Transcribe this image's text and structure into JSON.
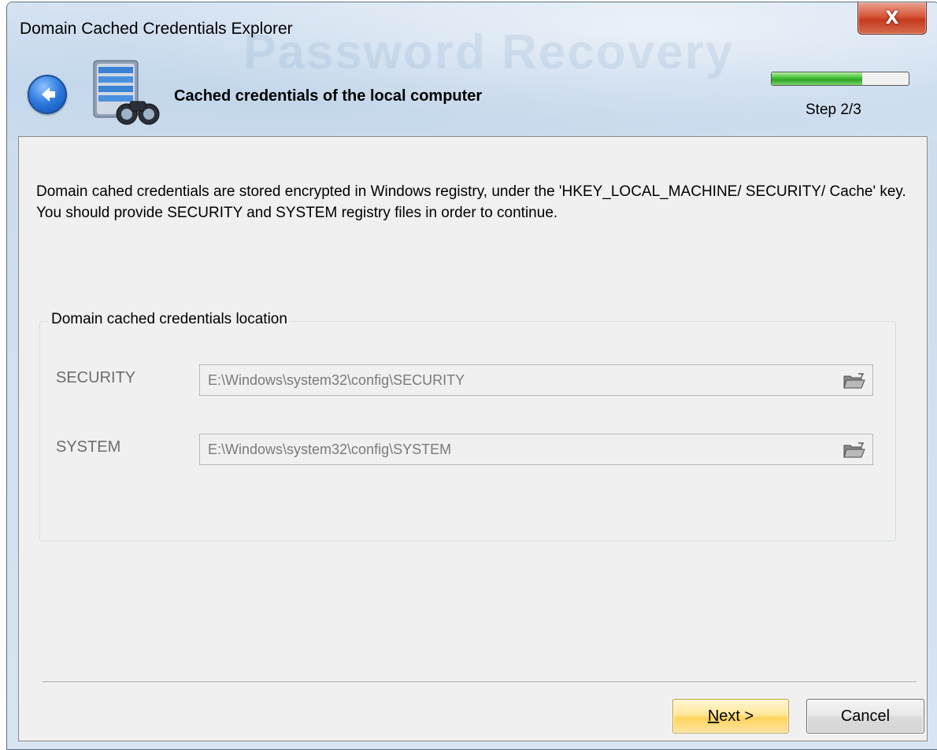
{
  "window": {
    "title": "Domain Cached Credentials Explorer",
    "close_glyph": "X",
    "ghost_text": "Password Recovery"
  },
  "header": {
    "title": "Cached credentials of the local computer",
    "step_label": "Step 2/3",
    "progress_fraction": 0.66,
    "back_icon": "back-arrow-icon",
    "app_icon": "database-binoculars-icon"
  },
  "description": "Domain cahed credentials are stored encrypted in Windows registry, under the 'HKEY_LOCAL_MACHINE/ SECURITY/ Cache' key. You should provide SECURITY and SYSTEM registry files in order to continue.",
  "group": {
    "legend": "Domain cached credentials location",
    "fields": [
      {
        "label": "SECURITY",
        "value": "E:\\Windows\\system32\\config\\SECURITY"
      },
      {
        "label": "SYSTEM",
        "value": "E:\\Windows\\system32\\config\\SYSTEM"
      }
    ]
  },
  "buttons": {
    "next_mnemonic": "N",
    "next_rest": "ext >",
    "cancel": "Cancel"
  },
  "colors": {
    "accent_blue": "#2b78dd",
    "progress_green": "#3fbd35",
    "close_red": "#c63b1e",
    "next_button_yellow": "#ffd35c"
  }
}
